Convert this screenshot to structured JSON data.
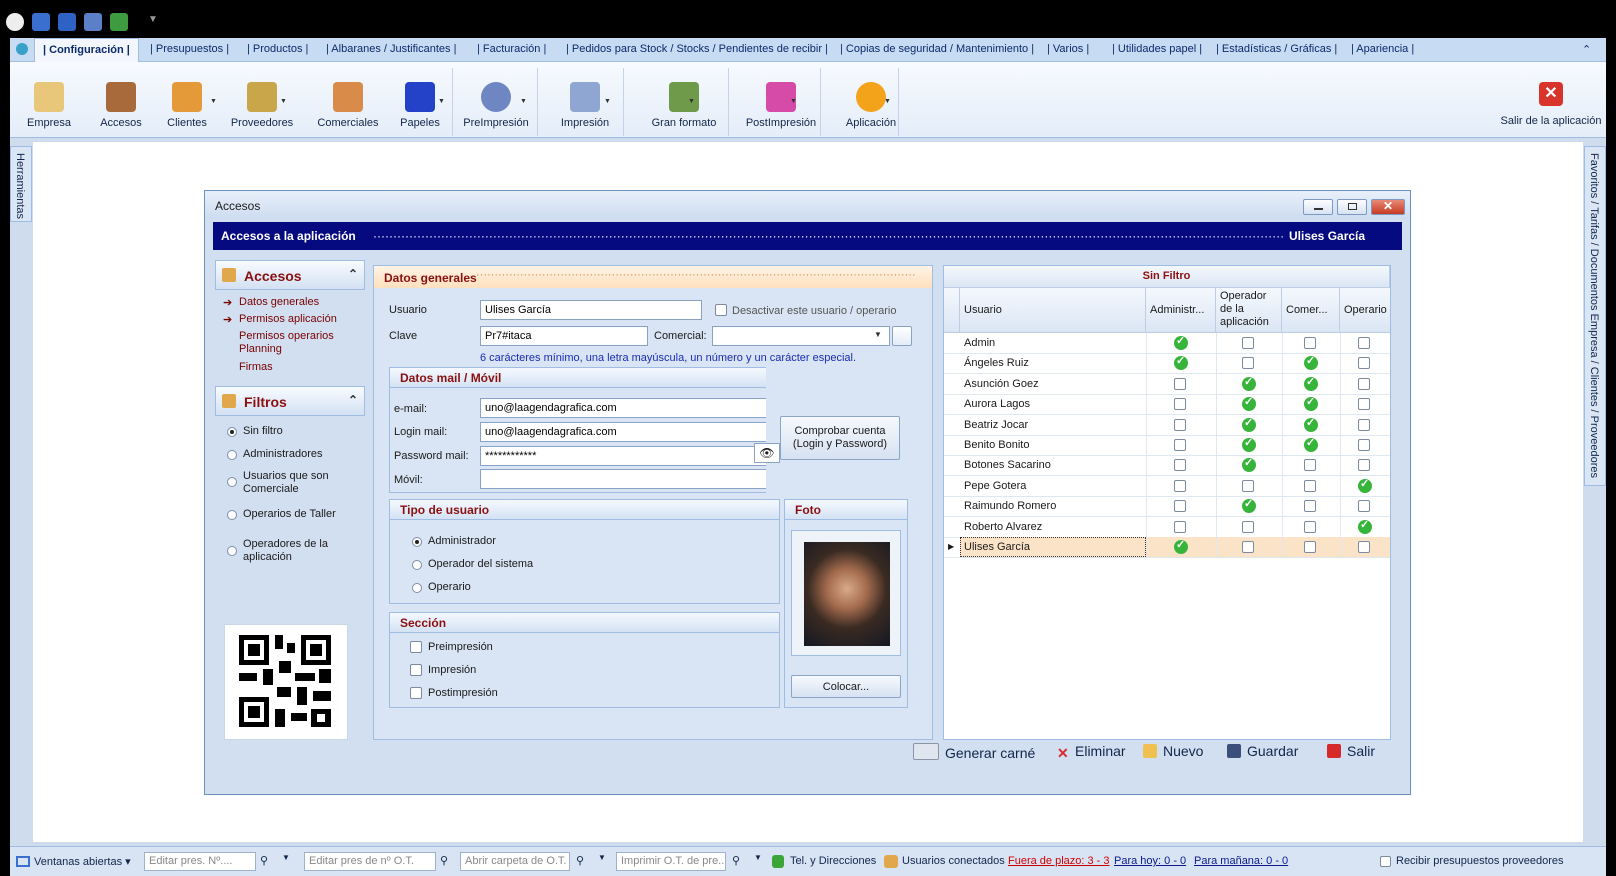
{
  "tabs": {
    "active": "| Configuración |",
    "items": [
      "| Presupuestos |",
      "| Productos |",
      "| Albaranes / Justificantes |",
      "| Facturación |",
      "| Pedidos para Stock / Stocks / Pendientes de recibir |",
      "| Copias de seguridad / Mantenimiento |",
      "| Varios |",
      "| Utilidades papel |",
      "| Estadísticas / Gráficas |",
      "| Apariencia |"
    ],
    "collapse": "⌃"
  },
  "ribbon": {
    "buttons": [
      "Empresa",
      "Accesos",
      "Clientes",
      "Proveedores",
      "Comerciales",
      "Papeles",
      "PreImpresión",
      "Impresión",
      "Gran formato",
      "PostImpresión",
      "Aplicación"
    ],
    "exit": "Salir de la aplicación"
  },
  "side": {
    "left": "Herramientas",
    "right": "Favoritos / Tarifas / Documentos Empresa / Clientes / Proveedores"
  },
  "window": {
    "title": "Accesos",
    "header_left": "Accesos a la aplicación",
    "header_dots": "········································································································································································································································",
    "header_right": "Ulises García"
  },
  "left_panel": {
    "accesos_title": "Accesos",
    "links": [
      "Datos generales",
      "Permisos aplicación",
      "Permisos operarios Planning",
      "Firmas"
    ],
    "filtros_title": "Filtros",
    "filters": [
      "Sin filtro",
      "Administradores",
      "Usuarios que son Comerciale",
      "Operarios de Taller",
      "Operadores de la aplicación"
    ]
  },
  "form": {
    "section_title": "Datos generales",
    "usuario_label": "Usuario",
    "usuario_value": "Ulises García",
    "deactivate_label": "Desactivar este usuario / operario",
    "clave_label": "Clave",
    "clave_value": "Pr7#itaca",
    "comercial_label": "Comercial:",
    "comercial_value": "",
    "hint": "6 carácteres mínimo, una letra mayúscula, un número y un carácter especial.",
    "mail_title": "Datos mail / Móvil",
    "email_label": "e-mail:",
    "email_value": "uno@laagendagrafica.com",
    "login_label": "Login mail:",
    "login_value": "uno@laagendagrafica.com",
    "password_label": "Password mail:",
    "password_value": "************",
    "movil_label": "Móvil:",
    "movil_value": "",
    "check_button": "Comprobar cuenta (Login y Password)",
    "tipo_title": "Tipo de usuario",
    "tipos": [
      "Administrador",
      "Operador del sistema",
      "Operario"
    ],
    "seccion_title": "Sección",
    "secciones": [
      "Preimpresión",
      "Impresión",
      "Postimpresión"
    ],
    "foto_title": "Foto",
    "foto_button": "Colocar..."
  },
  "grid": {
    "title": "Sin Filtro",
    "headers": [
      "Usuario",
      "Administr...",
      "Operador de la aplicación",
      "Comer...",
      "Operario"
    ],
    "rows": [
      {
        "name": "Admin",
        "flags": [
          true,
          false,
          false,
          false
        ]
      },
      {
        "name": "Ángeles Ruiz",
        "flags": [
          true,
          false,
          true,
          false
        ]
      },
      {
        "name": "Asunción Goez",
        "flags": [
          false,
          true,
          true,
          false
        ]
      },
      {
        "name": "Aurora Lagos",
        "flags": [
          false,
          true,
          true,
          false
        ]
      },
      {
        "name": "Beatriz Jocar",
        "flags": [
          false,
          true,
          true,
          false
        ]
      },
      {
        "name": "Benito Bonito",
        "flags": [
          false,
          true,
          true,
          false
        ]
      },
      {
        "name": "Botones Sacarino",
        "flags": [
          false,
          true,
          false,
          false
        ]
      },
      {
        "name": "Pepe Gotera",
        "flags": [
          false,
          false,
          false,
          true
        ]
      },
      {
        "name": "Raimundo Romero",
        "flags": [
          false,
          true,
          false,
          false
        ]
      },
      {
        "name": "Roberto Alvarez",
        "flags": [
          false,
          false,
          false,
          true
        ]
      },
      {
        "name": "Ulises García",
        "flags": [
          true,
          false,
          false,
          false
        ]
      }
    ]
  },
  "actions": [
    "Generar carné",
    "Eliminar",
    "Nuevo",
    "Guardar",
    "Salir"
  ],
  "status": {
    "ventanas": "Ventanas abiertas",
    "editar_pres": "Editar pres. Nº....",
    "editar_ot": "Editar pres de nº O.T.",
    "abrir_carpeta": "Abrir carpeta de O.T.",
    "imprimir_ot": "Imprimir O.T. de pre...",
    "tel": "Tel. y Direcciones",
    "usuarios": "Usuarios conectados",
    "fuera": "Fuera de plazo: 3 - 3",
    "hoy": "Para hoy: 0 - 0",
    "manana": "Para mañana: 0 - 0",
    "recibir": "Recibir presupuestos proveedores"
  },
  "colors": {
    "header_bg": "#050a80",
    "accent_red": "#8a1010",
    "check_green": "#37b53b",
    "selected_row": "#fbe3c7"
  }
}
